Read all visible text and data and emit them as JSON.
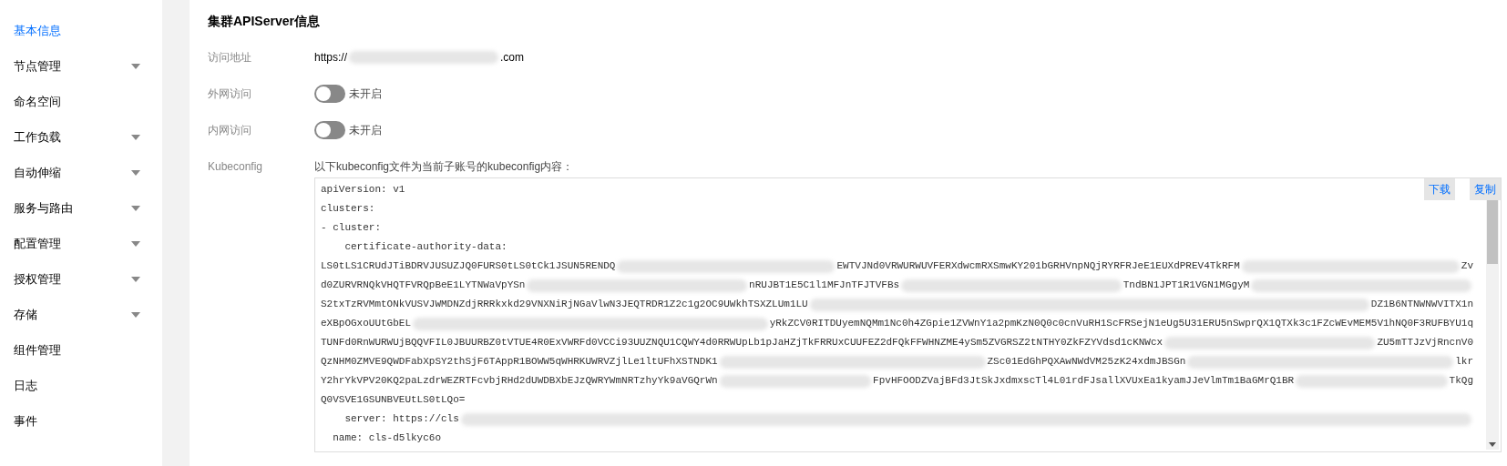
{
  "sidebar": {
    "items": [
      {
        "label": "基本信息",
        "selected": true,
        "has_submenu": false
      },
      {
        "label": "节点管理",
        "selected": false,
        "has_submenu": true
      },
      {
        "label": "命名空间",
        "selected": false,
        "has_submenu": false
      },
      {
        "label": "工作负载",
        "selected": false,
        "has_submenu": true
      },
      {
        "label": "自动伸缩",
        "selected": false,
        "has_submenu": true
      },
      {
        "label": "服务与路由",
        "selected": false,
        "has_submenu": true
      },
      {
        "label": "配置管理",
        "selected": false,
        "has_submenu": true
      },
      {
        "label": "授权管理",
        "selected": false,
        "has_submenu": true
      },
      {
        "label": "存储",
        "selected": false,
        "has_submenu": true
      },
      {
        "label": "组件管理",
        "selected": false,
        "has_submenu": false
      },
      {
        "label": "日志",
        "selected": false,
        "has_submenu": false
      },
      {
        "label": "事件",
        "selected": false,
        "has_submenu": false
      }
    ]
  },
  "section": {
    "title": "集群APIServer信息",
    "fields": [
      {
        "kind": "text",
        "label": "访问地址",
        "segments": [
          {
            "kind": "text",
            "text": "https://"
          },
          {
            "kind": "redacted"
          },
          {
            "kind": "text",
            "text": ".com"
          }
        ]
      },
      {
        "kind": "toggle",
        "label": "外网访问",
        "on": false,
        "state_text": "未开启"
      },
      {
        "kind": "toggle",
        "label": "内网访问",
        "on": false,
        "state_text": "未开启"
      },
      {
        "kind": "code",
        "label": "Kubeconfig",
        "note": "以下kubeconfig文件为当前子账号的kubeconfig内容：",
        "buttons": [
          "下载",
          "复制"
        ],
        "lines": [
          [
            {
              "kind": "text",
              "text": "apiVersion: v1"
            }
          ],
          [
            {
              "kind": "text",
              "text": "clusters:"
            }
          ],
          [
            {
              "kind": "text",
              "text": "- cluster:"
            }
          ],
          [
            {
              "kind": "text",
              "text": "    certificate-authority-data:"
            }
          ],
          [
            {
              "kind": "text",
              "text": "LS0tLS1CRUdJTiBDRVJUSUZJQ0FURS0tLS0tCk1JSUN5RENDQ"
            },
            {
              "kind": "redacted"
            },
            {
              "kind": "text",
              "text": "EWTVJNd0VRWURWUVFERXdwcmRXSmwKY201bGRHVnpNQjRYRFRJeE1EUXdPREV4TkRFM"
            },
            {
              "kind": "redacted"
            },
            {
              "kind": "text",
              "text": "Zv"
            }
          ],
          [
            {
              "kind": "text",
              "text": "d0ZURVRNQkVHQTFVRQpBeE1LYTNWaVpYSn"
            },
            {
              "kind": "redacted"
            },
            {
              "kind": "text",
              "text": "nRUJBT1E5C1l1MFJnTFJTVFBs"
            },
            {
              "kind": "redacted"
            },
            {
              "kind": "text",
              "text": "TndBN1JPT1R1VGN1MGgyM"
            },
            {
              "kind": "redacted"
            }
          ],
          [
            {
              "kind": "text",
              "text": "S2txTzRVMmtONkVUSVJWMDNZdjRRRkxkd29VNXNiRjNGaVlwN3JEQTRDR1Z2c1g2OC9UWkhTSXZLUm1LU"
            },
            {
              "kind": "redacted"
            },
            {
              "kind": "text",
              "text": "DZ1B6NTNWNWVITX1n"
            }
          ],
          [
            {
              "kind": "text",
              "text": "eXBpOGxoUUtGbEL"
            },
            {
              "kind": "redacted"
            },
            {
              "kind": "text",
              "text": "yRkZCV0RITDUyemNQMm1Nc0h4ZGpie1ZVWnY1a2pmKzN0Q0c0cnVuRH1ScFRSejN1eUg5U31ERU5nSwprQX1QTXk3c1FZcWEvMEM5V1hNQ0F3RUFBYU1q"
            }
          ],
          [
            {
              "kind": "text",
              "text": "TUNFd0RnWURWUjBQQVFIL0JBUURBZ0tVTUE4R0ExVWRFd0VCCi93UUZNQU1CQWY4d0RRWUpLb1pJaHZjTkFRRUxCUUFEZ2dFQkFFWHNZME4ySm5ZVGRSZ2tNTHY0ZkFZYVdsd1cKNWcx"
            },
            {
              "kind": "redacted"
            },
            {
              "kind": "text",
              "text": "ZU5mTTJzVjRncnV0"
            }
          ],
          [
            {
              "kind": "text",
              "text": "QzNHM0ZMVE9QWDFabXpSY2thSjF6TAppR1BOWW5qWHRKUWRVZjlLe1ltUFhXSTNDK1"
            },
            {
              "kind": "redacted"
            },
            {
              "kind": "text",
              "text": "ZSc01EdGhPQXAwNWdVM25zK24xdmJBSGn"
            },
            {
              "kind": "redacted"
            },
            {
              "kind": "text",
              "text": "lkr"
            }
          ],
          [
            {
              "kind": "text",
              "text": "Y2hrYkVPV20KQ2paLzdrWEZRTFcvbjRHd2dUWDBXbEJzQWRYWmNRTzhyYk9aVGQrWn"
            },
            {
              "kind": "redacted"
            },
            {
              "kind": "text",
              "text": "FpvHFOODZVajBFd3JtSkJxdmxscTl4L01rdFJsallXVUxEa1kyamJJeVlmTm1BaGMrQ1BR"
            },
            {
              "kind": "redacted"
            },
            {
              "kind": "text",
              "text": "TkQg"
            }
          ],
          [
            {
              "kind": "text",
              "text": "Q0VSVE1GSUNBVEUtLS0tLQo="
            }
          ],
          [
            {
              "kind": "text",
              "text": "    server: https://cls"
            },
            {
              "kind": "redacted"
            }
          ],
          [
            {
              "kind": "text",
              "text": "  name: cls-d5lkyc6o"
            }
          ]
        ]
      }
    ]
  }
}
